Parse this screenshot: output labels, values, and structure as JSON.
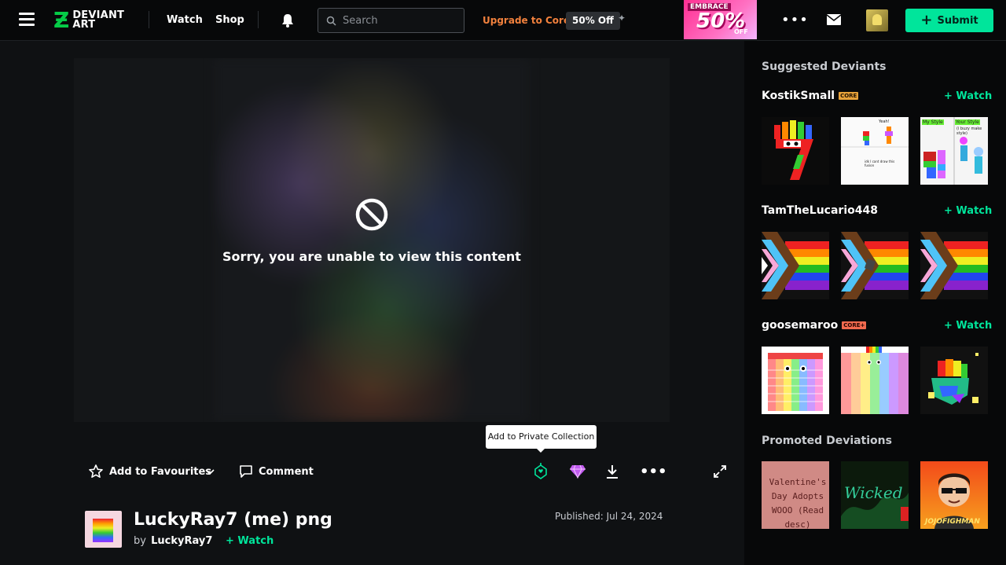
{
  "header": {
    "logo_top": "DEVIANT",
    "logo_bottom": "ART",
    "nav_watch": "Watch",
    "nav_shop": "Shop",
    "search_placeholder": "Search",
    "upgrade_label": "Upgrade to Core",
    "discount_badge": "50% Off",
    "ad_top": "EMBRACE",
    "ad_big": "50%",
    "ad_small": "OFF",
    "submit_label": "Submit"
  },
  "viewer": {
    "message": "Sorry, you are unable to view this content"
  },
  "tooltip": "Add to Private Collection",
  "actions": {
    "favourite_label": "Add to Favourites",
    "comment_label": "Comment"
  },
  "deviation": {
    "title": "LuckyRay7 (me) png",
    "by_prefix": "by",
    "author": "LuckyRay7",
    "watch_label": "Watch",
    "published": "Published: Jul 24, 2024"
  },
  "sidebar": {
    "suggested_heading": "Suggested Deviants",
    "promoted_heading": "Promoted Deviations",
    "watch_label": "Watch",
    "deviants": [
      {
        "name": "KostikSmall",
        "badge": "CORE"
      },
      {
        "name": "TamTheLucario448",
        "badge": ""
      },
      {
        "name": "goosemaroo",
        "badge": "CORE+"
      }
    ],
    "thumb_texts": {
      "kostik_2": "Yeah!",
      "kostik_2_sub": "idk I cant draw this fusion",
      "kostik_3_a": "My Style",
      "kostik_3_b": "Your Style",
      "kostik_3_sub": "(i buzy make style)",
      "promo_1": "Valentine's Day Adopts WOOO (Read desc)",
      "promo_2": "Wicked",
      "promo_3": "JOJOFIGHMAN"
    }
  },
  "colors": {
    "accent": "#00e59b",
    "upgrade": "#f2813d",
    "logo": "#05cc47"
  }
}
